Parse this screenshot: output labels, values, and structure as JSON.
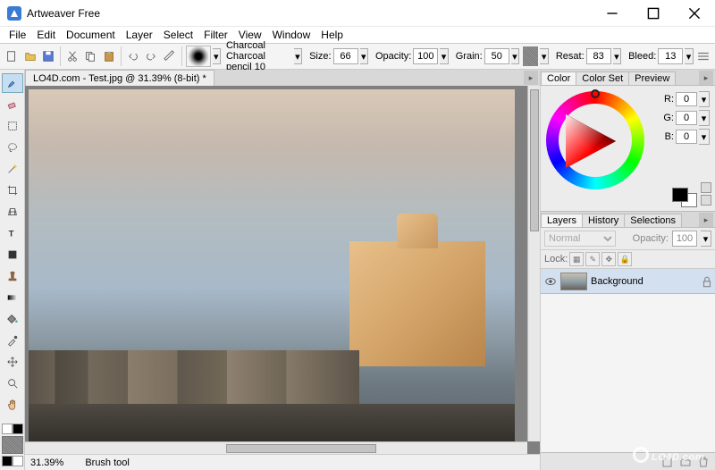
{
  "window": {
    "title": "Artweaver Free",
    "min": "—",
    "max": "□",
    "close": "✕"
  },
  "menu": [
    "File",
    "Edit",
    "Document",
    "Layer",
    "Select",
    "Filter",
    "View",
    "Window",
    "Help"
  ],
  "toolbar": {
    "brush_category": "Charcoal",
    "brush_variant": "Charcoal pencil 10",
    "size_label": "Size:",
    "size": "66",
    "opacity_label": "Opacity:",
    "opacity": "100",
    "grain_label": "Grain:",
    "grain": "50",
    "resat_label": "Resat:",
    "resat": "83",
    "bleed_label": "Bleed:",
    "bleed": "13"
  },
  "document": {
    "tab_title": "LO4D.com - Test.jpg @ 31.39% (8-bit) *",
    "zoom": "31.39%",
    "status_tool": "Brush tool"
  },
  "color_panel": {
    "tabs": [
      "Color",
      "Color Set",
      "Preview"
    ],
    "r_label": "R:",
    "g_label": "G:",
    "b_label": "B:",
    "r": "0",
    "g": "0",
    "b": "0"
  },
  "layers_panel": {
    "tabs": [
      "Layers",
      "History",
      "Selections"
    ],
    "blend_mode": "Normal",
    "opacity_label": "Opacity:",
    "opacity": "100",
    "lock_label": "Lock:",
    "layers": [
      {
        "name": "Background",
        "visible": true,
        "locked": true
      }
    ]
  },
  "tools": [
    "brush",
    "eraser",
    "selection-rect",
    "lasso",
    "magic-wand",
    "crop",
    "perspective",
    "text",
    "shape",
    "stamp",
    "gradient",
    "fill",
    "dropper",
    "move",
    "zoom",
    "hand"
  ],
  "watermark": "LO4D.com"
}
